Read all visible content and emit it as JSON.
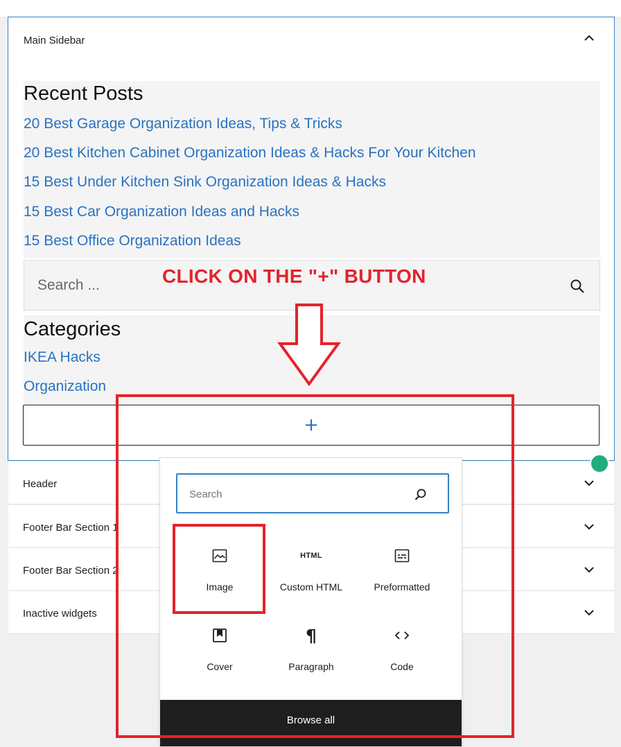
{
  "main_sidebar": {
    "title": "Main Sidebar",
    "recent_posts": {
      "heading": "Recent Posts",
      "links": [
        "20 Best Garage Organization Ideas, Tips & Tricks",
        "20 Best Kitchen Cabinet Organization Ideas & Hacks For Your Kitchen",
        "15 Best Under Kitchen Sink Organization Ideas & Hacks",
        "15 Best Car Organization Ideas and Hacks",
        "15 Best Office Organization Ideas"
      ]
    },
    "search": {
      "placeholder": "Search ..."
    },
    "categories": {
      "heading": "Categories",
      "links": [
        "IKEA Hacks",
        "Organization"
      ]
    },
    "add_block_symbol": "+"
  },
  "collapsed_panels": [
    "Header",
    "Footer Bar Section 1",
    "Footer Bar Section 2",
    "Inactive widgets"
  ],
  "inserter": {
    "search_placeholder": "Search",
    "blocks": [
      {
        "label": "Image",
        "icon": "image-icon"
      },
      {
        "label": "Custom HTML",
        "icon": "html-icon",
        "glyph": "HTML"
      },
      {
        "label": "Preformatted",
        "icon": "preformatted-icon"
      },
      {
        "label": "Cover",
        "icon": "cover-icon"
      },
      {
        "label": "Paragraph",
        "icon": "paragraph-icon",
        "glyph": "¶"
      },
      {
        "label": "Code",
        "icon": "code-icon"
      }
    ],
    "browse_all": "Browse all"
  },
  "annotation": {
    "text": "CLICK ON THE \"+\" BUTTON",
    "color": "#e3232c"
  },
  "colors": {
    "link": "#2872c2",
    "focus_blue": "#3582c4",
    "dark": "#1e1e1e"
  }
}
